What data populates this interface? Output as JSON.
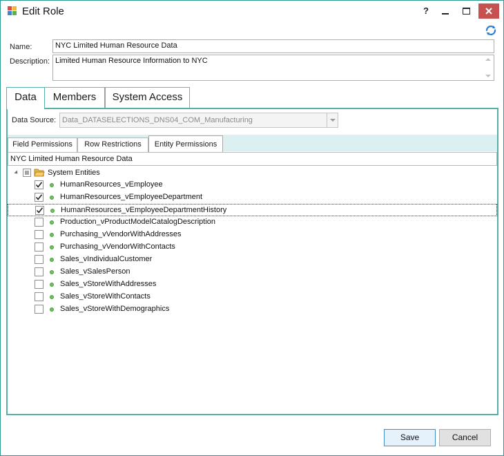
{
  "window": {
    "title": "Edit Role",
    "help_label": "?",
    "min_label": "–",
    "max_label": "□",
    "close_label": "✕"
  },
  "form": {
    "name_label": "Name:",
    "name_value": "NYC Limited Human Resource Data",
    "description_label": "Description:",
    "description_value": "Limited Human Resource Information to NYC"
  },
  "tabs": [
    {
      "label": "Data",
      "active": true
    },
    {
      "label": "Members",
      "active": false
    },
    {
      "label": "System Access",
      "active": false
    }
  ],
  "data_tab": {
    "data_source_label": "Data Source:",
    "data_source_value": "Data_DATASELECTIONS_DNS04_COM_Manufacturing"
  },
  "subtabs": [
    {
      "label": "Field Permissions",
      "active": false
    },
    {
      "label": "Row Restrictions",
      "active": false
    },
    {
      "label": "Entity Permissions",
      "active": true
    }
  ],
  "tree": {
    "header": "NYC Limited Human Resource Data",
    "root_label": "System Entities",
    "root_state": "indeterminate",
    "items": [
      {
        "label": "HumanResources_vEmployee",
        "checked": true,
        "focused": false
      },
      {
        "label": "HumanResources_vEmployeeDepartment",
        "checked": true,
        "focused": false
      },
      {
        "label": "HumanResources_vEmployeeDepartmentHistory",
        "checked": true,
        "focused": true
      },
      {
        "label": "Production_vProductModelCatalogDescription",
        "checked": false,
        "focused": false
      },
      {
        "label": "Purchasing_vVendorWithAddresses",
        "checked": false,
        "focused": false
      },
      {
        "label": "Purchasing_vVendorWithContacts",
        "checked": false,
        "focused": false
      },
      {
        "label": "Sales_vIndividualCustomer",
        "checked": false,
        "focused": false
      },
      {
        "label": "Sales_vSalesPerson",
        "checked": false,
        "focused": false
      },
      {
        "label": "Sales_vStoreWithAddresses",
        "checked": false,
        "focused": false
      },
      {
        "label": "Sales_vStoreWithContacts",
        "checked": false,
        "focused": false
      },
      {
        "label": "Sales_vStoreWithDemographics",
        "checked": false,
        "focused": false
      }
    ]
  },
  "buttons": {
    "save_label": "Save",
    "cancel_label": "Cancel"
  },
  "colors": {
    "accent": "#56b0aa",
    "subtab_strip": "#dceff1",
    "entity_dot": "#6cc35a"
  },
  "icons": [
    "app-icon",
    "refresh-icon",
    "folder-icon",
    "checkbox",
    "entity-dot-icon",
    "dropdown-arrow-icon"
  ]
}
